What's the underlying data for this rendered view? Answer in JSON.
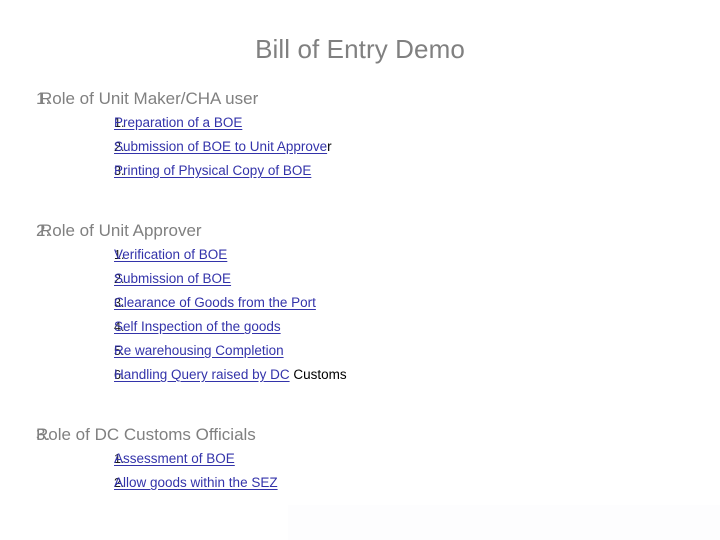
{
  "slide": {
    "title": "Bill of Entry Demo",
    "title_color": "#808080",
    "link_color": "#3333AA",
    "background": "#FFFFFF",
    "sections": [
      {
        "number": "1.",
        "heading": "Role of Unit Maker/CHA user",
        "items": [
          {
            "number": "1.",
            "link_text": "Preparation of a BOE",
            "plain_text": ""
          },
          {
            "number": "2.",
            "link_text": "Submission of BOE to Unit Approve",
            "plain_text": "r"
          },
          {
            "number": "3.",
            "link_text": "Printing of Physical Copy of BOE",
            "plain_text": ""
          }
        ]
      },
      {
        "number": "2.",
        "heading": "Role of Unit Approver",
        "items": [
          {
            "number": "1.",
            "link_text": "Verification of BOE",
            "plain_text": ""
          },
          {
            "number": "2.",
            "link_text": "Submission of BOE",
            "plain_text": ""
          },
          {
            "number": "3.",
            "link_text": "Clearance of Goods from the Port",
            "plain_text": ""
          },
          {
            "number": "4.",
            "link_text": "Self Inspection of the goods",
            "plain_text": ""
          },
          {
            "number": "5.",
            "link_text": "Re warehousing Completion",
            "plain_text": ""
          },
          {
            "number": "6.",
            "link_text": "Handling Query raised by DC",
            "plain_text": " Customs"
          }
        ]
      },
      {
        "number": "3.",
        "heading": "Role of DC Customs Officials",
        "items": [
          {
            "number": "1.",
            "link_text": "Assessment of BOE",
            "plain_text": ""
          },
          {
            "number": "2.",
            "link_text": "Allow  goods within the SEZ",
            "plain_text": ""
          }
        ]
      }
    ]
  }
}
